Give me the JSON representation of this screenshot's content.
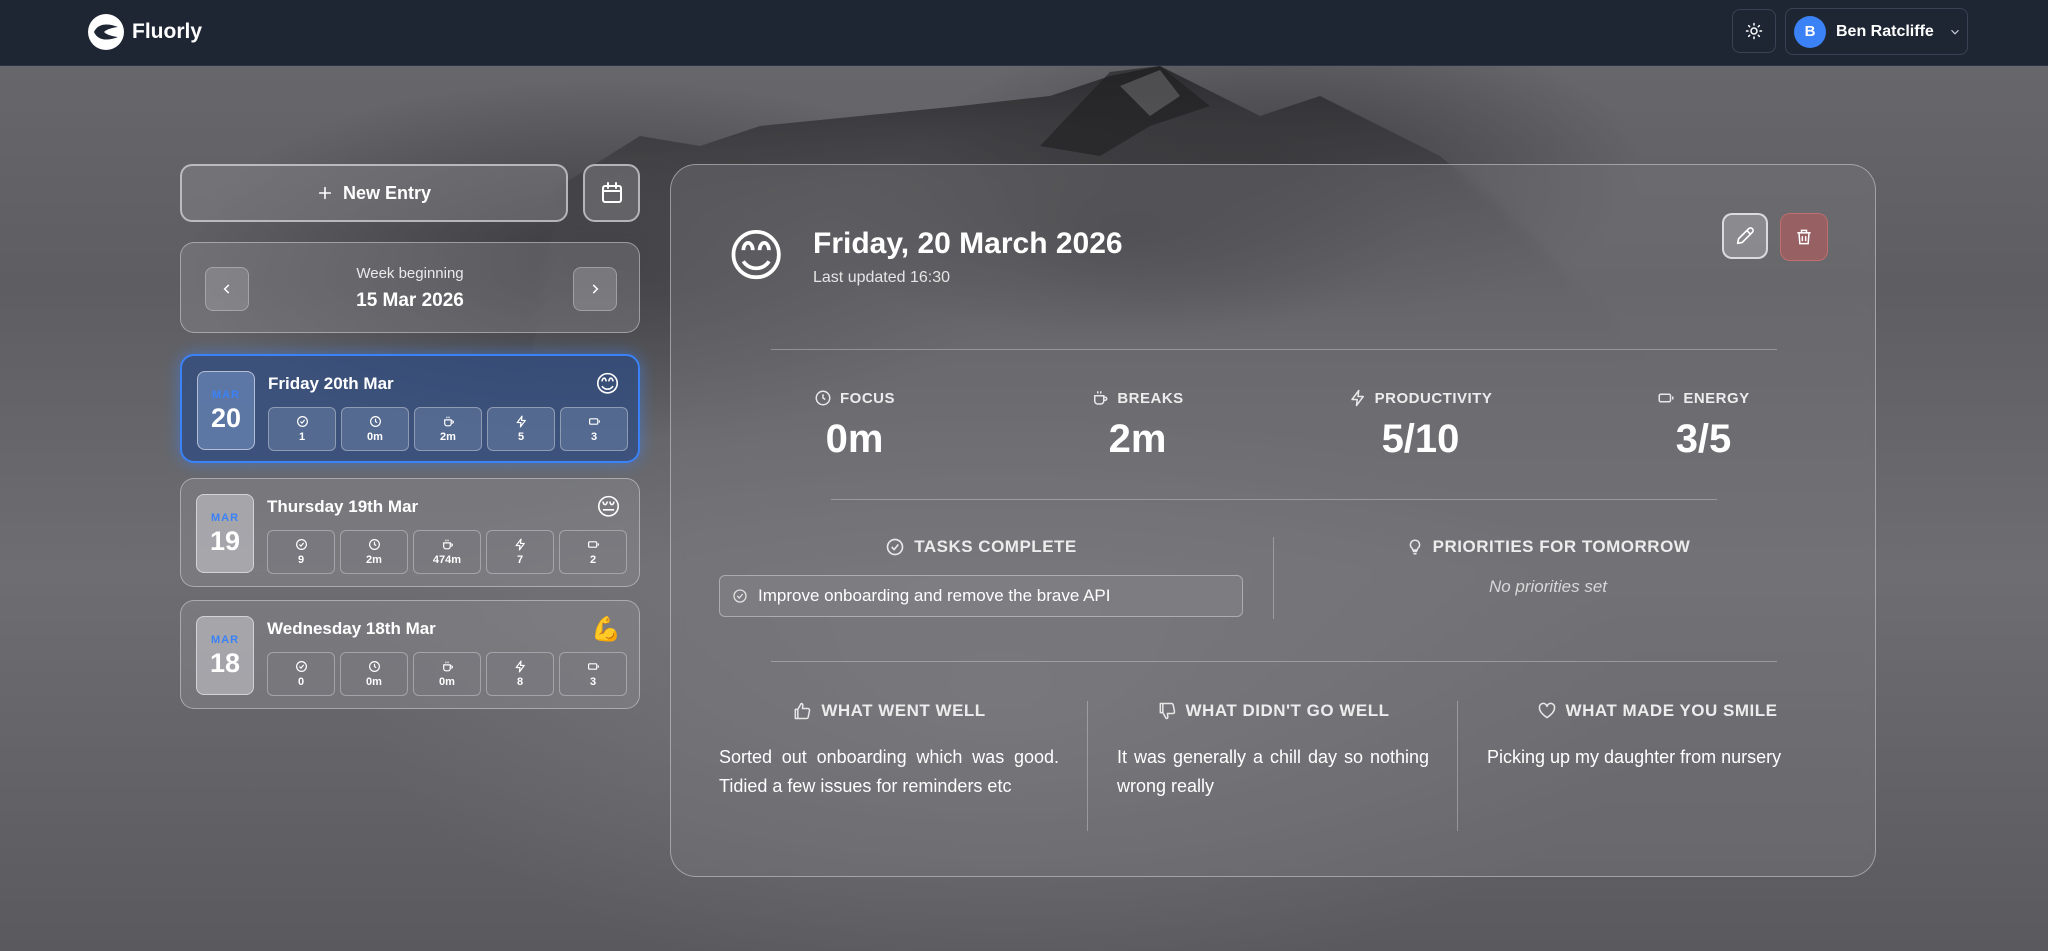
{
  "app": {
    "name": "Fluorly"
  },
  "user": {
    "initial": "B",
    "name": "Ben Ratcliffe"
  },
  "sidebar": {
    "new_entry_label": "New Entry",
    "week_label": "Week beginning",
    "week_date": "15 Mar 2026",
    "days": [
      {
        "month": "MAR",
        "day": "20",
        "title": "Friday 20th Mar",
        "emoji": "😊",
        "stats": [
          "1",
          "0m",
          "2m",
          "5",
          "3"
        ],
        "active": true
      },
      {
        "month": "MAR",
        "day": "19",
        "title": "Thursday 19th Mar",
        "emoji": "😔",
        "stats": [
          "9",
          "2m",
          "474m",
          "7",
          "2"
        ],
        "active": false
      },
      {
        "month": "MAR",
        "day": "18",
        "title": "Wednesday 18th Mar",
        "emoji": "💪",
        "stats": [
          "0",
          "0m",
          "0m",
          "8",
          "3"
        ],
        "active": false
      }
    ]
  },
  "entry": {
    "emoji": "😊",
    "title": "Friday, 20 March 2026",
    "updated": "Last updated 16:30",
    "metrics": [
      {
        "label": "FOCUS",
        "value": "0m",
        "icon": "clock-icon"
      },
      {
        "label": "BREAKS",
        "value": "2m",
        "icon": "coffee-icon"
      },
      {
        "label": "PRODUCTIVITY",
        "value": "5/10",
        "icon": "bolt-icon"
      },
      {
        "label": "ENERGY",
        "value": "3/5",
        "icon": "battery-icon"
      }
    ],
    "tasks_title": "TASKS COMPLETE",
    "tasks": [
      "Improve onboarding and remove the brave API"
    ],
    "priorities_title": "PRIORITIES FOR TOMORROW",
    "priorities_empty": "No priorities set",
    "went_well_title": "WHAT WENT WELL",
    "went_well_text": "Sorted out onboarding which was good. Tidied a few issues for reminders etc",
    "didnt_go_well_title": "WHAT DIDN'T GO WELL",
    "didnt_go_well_text": "It was generally a chill day so nothing wrong really",
    "smile_title": "WHAT MADE YOU SMILE",
    "smile_text": "Picking up my daughter from nursery"
  },
  "colors": {
    "accent": "#3b82f6",
    "topbar": "#1e2533",
    "delete": "#c05a5a"
  }
}
